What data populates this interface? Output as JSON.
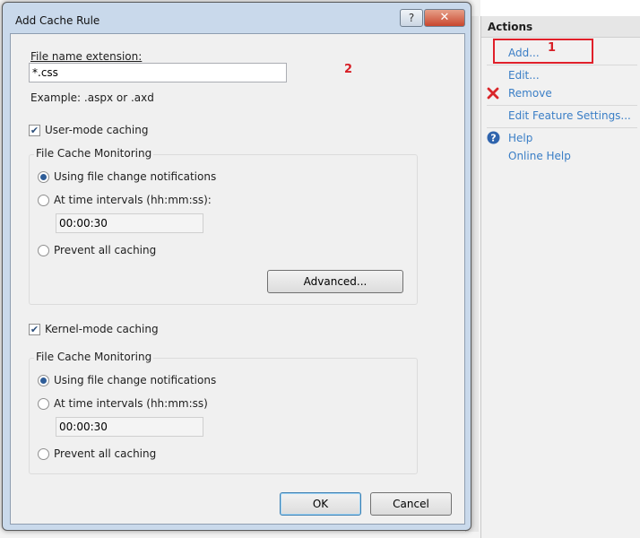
{
  "dialog": {
    "title": "Add Cache Rule",
    "help_glyph": "?",
    "close_glyph": "✕"
  },
  "form": {
    "extension_label": "File name extension:",
    "extension_value": "*.css",
    "example_text": "Example: .aspx or .axd",
    "user_mode": {
      "label": "User-mode caching",
      "checked": true,
      "group_title": "File Cache Monitoring",
      "option_notifications": "Using file change notifications",
      "option_intervals": "At time intervals (hh:mm:ss):",
      "interval_value": "00:00:30",
      "option_prevent": "Prevent all caching",
      "advanced_label": "Advanced..."
    },
    "kernel_mode": {
      "label": "Kernel-mode caching",
      "checked": true,
      "group_title": "File Cache Monitoring",
      "option_notifications": "Using file change notifications",
      "option_intervals": "At time intervals (hh:mm:ss)",
      "interval_value": "00:00:30",
      "option_prevent": "Prevent all caching"
    },
    "ok_label": "OK",
    "cancel_label": "Cancel"
  },
  "actions": {
    "header": "Actions",
    "add": "Add...",
    "edit": "Edit...",
    "remove": "Remove",
    "edit_feature": "Edit Feature Settings...",
    "help": "Help",
    "online_help": "Online Help"
  },
  "annotations": {
    "one": "1",
    "two": "2"
  },
  "colors": {
    "link": "#3a7ec6",
    "annotation": "#d71f26",
    "remove_icon": "#d9262a",
    "help_icon": "#2f64ad"
  }
}
